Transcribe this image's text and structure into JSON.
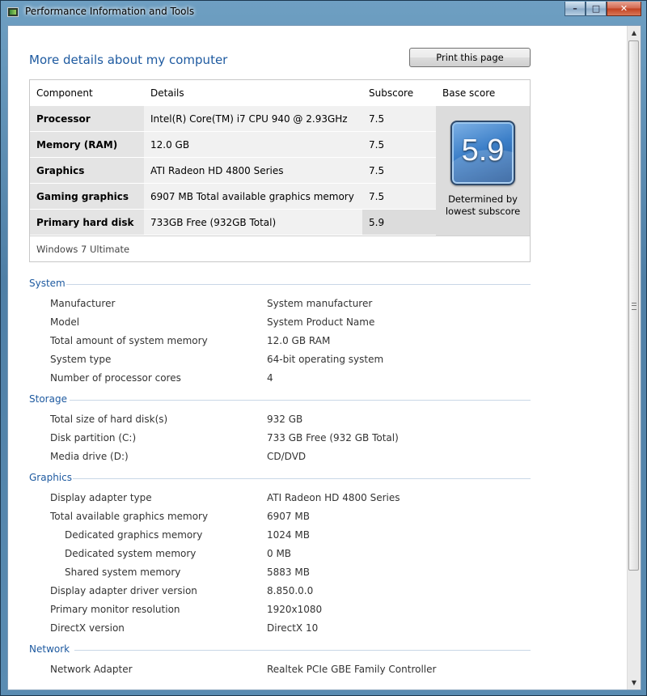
{
  "window": {
    "title": "Performance Information and Tools",
    "minimize": "–",
    "maximize": "□",
    "close": "✕"
  },
  "page": {
    "heading": "More details about my computer",
    "print_label": "Print this page"
  },
  "score_table": {
    "headers": {
      "component": "Component",
      "details": "Details",
      "subscore": "Subscore",
      "base": "Base score"
    },
    "rows": [
      {
        "component": "Processor",
        "details": "Intel(R) Core(TM) i7 CPU 940 @ 2.93GHz",
        "subscore": "7.5"
      },
      {
        "component": "Memory (RAM)",
        "details": "12.0 GB",
        "subscore": "7.5"
      },
      {
        "component": "Graphics",
        "details": "ATI Radeon HD 4800 Series",
        "subscore": "7.5"
      },
      {
        "component": "Gaming graphics",
        "details": "6907 MB Total available graphics memory",
        "subscore": "7.5"
      },
      {
        "component": "Primary hard disk",
        "details": "733GB Free (932GB Total)",
        "subscore": "5.9"
      }
    ],
    "base_score": "5.9",
    "base_note_1": "Determined by",
    "base_note_2": "lowest subscore",
    "os": "Windows 7 Ultimate"
  },
  "sections": {
    "system": {
      "title": "System",
      "rows": [
        {
          "label": "Manufacturer",
          "value": "System manufacturer"
        },
        {
          "label": "Model",
          "value": "System Product Name"
        },
        {
          "label": "Total amount of system memory",
          "value": "12.0 GB RAM"
        },
        {
          "label": "System type",
          "value": "64-bit operating system"
        },
        {
          "label": "Number of processor cores",
          "value": "4"
        }
      ]
    },
    "storage": {
      "title": "Storage",
      "rows": [
        {
          "label": "Total size of hard disk(s)",
          "value": "932 GB"
        },
        {
          "label": "Disk partition (C:)",
          "value": "733 GB Free (932 GB Total)"
        },
        {
          "label": "Media drive (D:)",
          "value": "CD/DVD"
        }
      ]
    },
    "graphics": {
      "title": "Graphics",
      "rows": [
        {
          "label": "Display adapter type",
          "value": "ATI Radeon HD 4800 Series"
        },
        {
          "label": "Total available graphics memory",
          "value": "6907 MB"
        },
        {
          "label": "Dedicated graphics memory",
          "value": "1024 MB"
        },
        {
          "label": "Dedicated system memory",
          "value": "0 MB"
        },
        {
          "label": "Shared system memory",
          "value": "5883 MB"
        },
        {
          "label": "Display adapter driver version",
          "value": "8.850.0.0"
        },
        {
          "label": "Primary monitor resolution",
          "value": "1920x1080"
        },
        {
          "label": "DirectX version",
          "value": "DirectX 10"
        }
      ]
    },
    "network": {
      "title": "Network",
      "rows": [
        {
          "label": "Network Adapter",
          "value": "Realtek PCIe GBE Family Controller"
        }
      ]
    }
  },
  "colors": {
    "heading": "#1e5aa0",
    "row_label_bg": "#e4e4e4",
    "row_detail_bg": "#f1f1f1"
  },
  "icons": {
    "app": "performance-app-icon",
    "scroll_up": "scroll-up-arrow-icon",
    "scroll_down": "scroll-down-arrow-icon"
  }
}
